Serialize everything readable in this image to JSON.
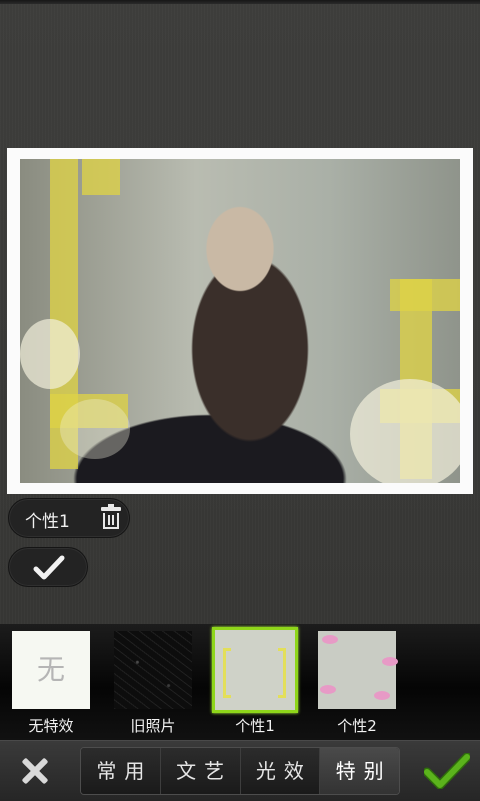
{
  "effect_chip": {
    "label": "个性1",
    "trash_icon": "trash-icon"
  },
  "apply_chip": {
    "icon": "checkmark-icon"
  },
  "effects": [
    {
      "label": "无特效",
      "thumb_text": "无",
      "selected": false
    },
    {
      "label": "旧照片",
      "selected": false
    },
    {
      "label": "个性1",
      "selected": true
    },
    {
      "label": "个性2",
      "selected": false
    }
  ],
  "tabs": [
    {
      "label": "常用",
      "active": false
    },
    {
      "label": "文艺",
      "active": false
    },
    {
      "label": "光效",
      "active": false
    },
    {
      "label": "特别",
      "active": true
    }
  ],
  "colors": {
    "selected_border": "#8fd61a",
    "confirm_green": "#5bb31c",
    "background": "#3a3a38"
  },
  "icons": {
    "cancel": "close-icon",
    "confirm": "checkmark-icon"
  }
}
